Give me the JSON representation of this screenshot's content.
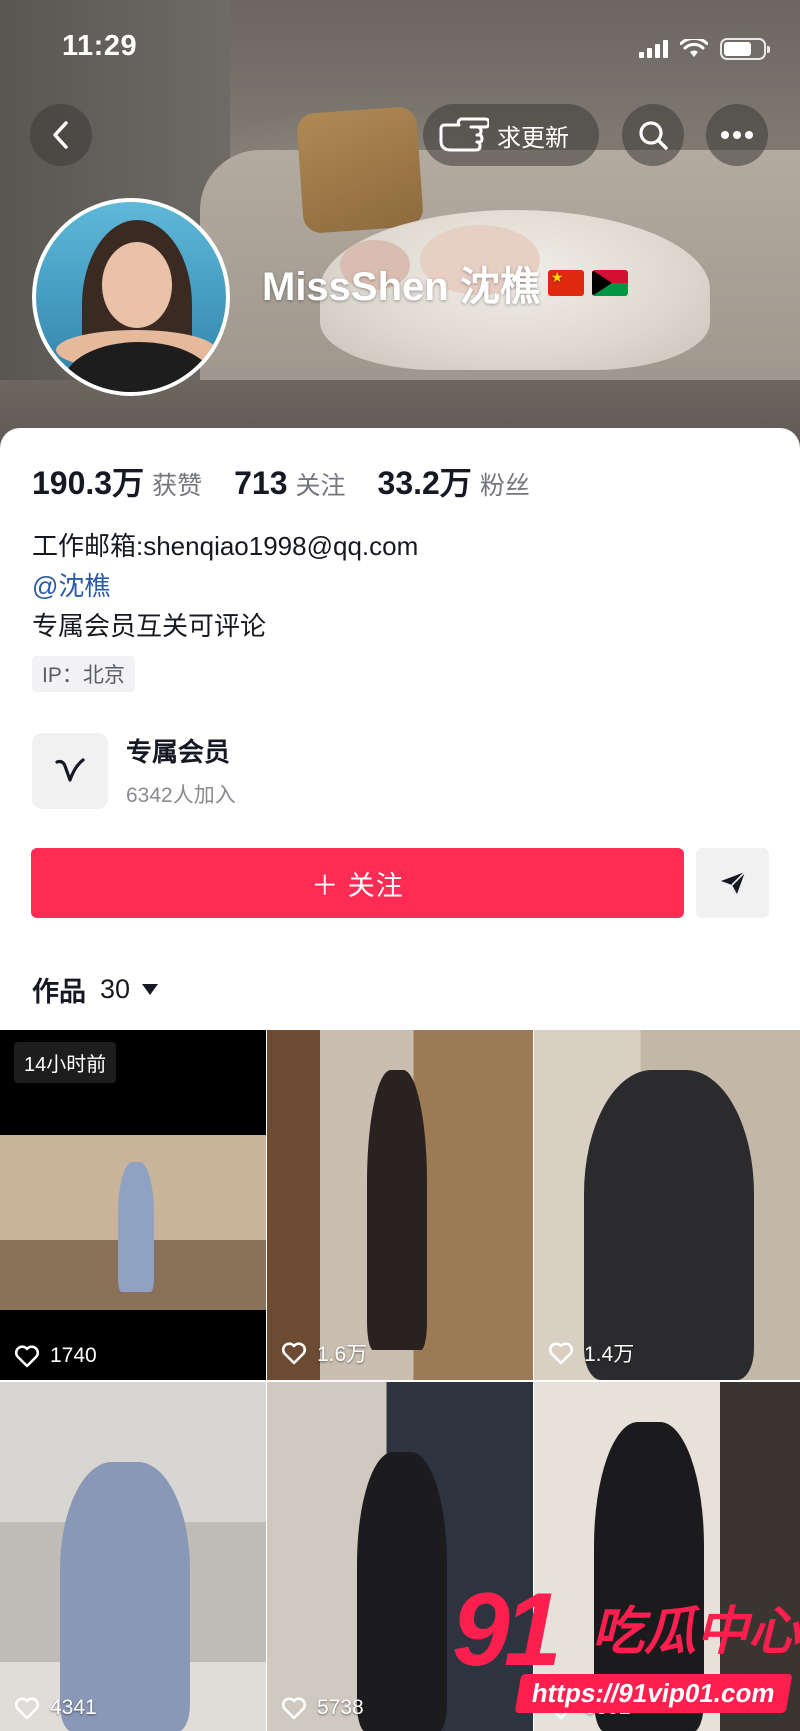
{
  "status_bar": {
    "time": "11:29"
  },
  "header": {
    "update_label": "求更新",
    "nickname": "MissShen 沈樵",
    "flags": [
      "flag-china",
      "flag-vanuatu"
    ]
  },
  "stats": [
    {
      "value": "190.3万",
      "label": "获赞"
    },
    {
      "value": "713",
      "label": "关注"
    },
    {
      "value": "33.2万",
      "label": "粉丝"
    }
  ],
  "bio": {
    "email": "工作邮箱:shenqiao1998@qq.com",
    "mention": "@沈樵",
    "desc": "专属会员互关可评论",
    "ip": "IP：北京"
  },
  "member": {
    "title": "专属会员",
    "subtitle": "6342人加入"
  },
  "actions": {
    "follow_label": "＋ 关注"
  },
  "works": {
    "label": "作品",
    "count": "30"
  },
  "videos": [
    {
      "badge": "14小时前",
      "likes": "1740"
    },
    {
      "likes": "1.6万"
    },
    {
      "likes": "1.4万"
    },
    {
      "likes": "4341"
    },
    {
      "likes": "5738"
    },
    {
      "likes": "6892"
    }
  ],
  "watermark": {
    "number": "91",
    "text": "吃瓜中心",
    "url": "https://91vip01.com"
  },
  "colors": {
    "accent": "#fe2c55",
    "mention": "#2b5ba6",
    "text": "#161823",
    "secondary": "#747680"
  }
}
